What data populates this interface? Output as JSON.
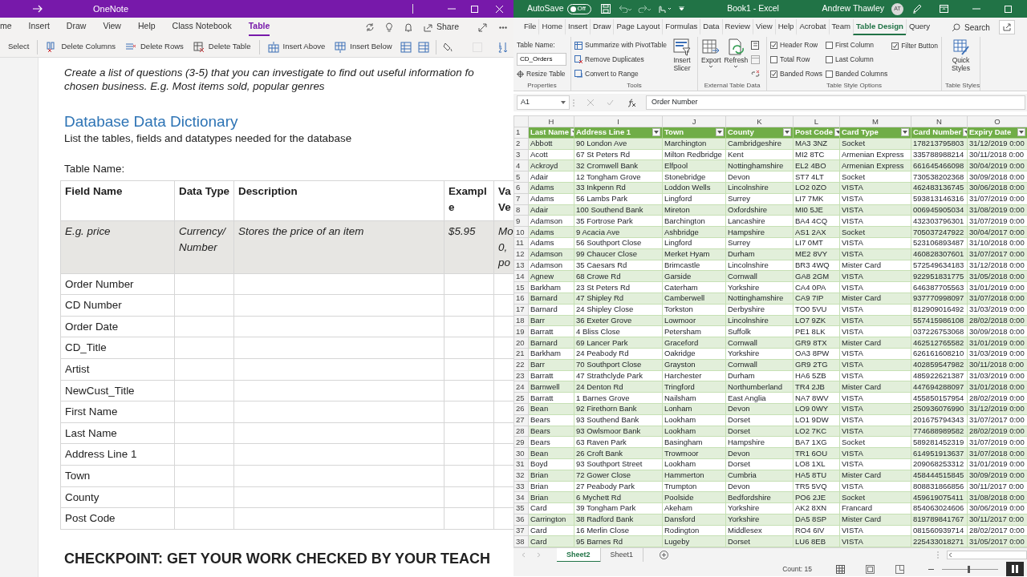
{
  "onenote": {
    "title": "OneNote",
    "tabs": [
      {
        "label": "me",
        "selected": false
      },
      {
        "label": "Insert",
        "selected": false
      },
      {
        "label": "Draw",
        "selected": false
      },
      {
        "label": "View",
        "selected": false
      },
      {
        "label": "Help",
        "selected": false
      },
      {
        "label": "Class Notebook",
        "selected": false
      },
      {
        "label": "Table",
        "selected": true
      }
    ],
    "share": "Share",
    "ribbon": [
      {
        "label": "Select",
        "kind": "text"
      },
      {
        "label": "Delete Columns",
        "kind": "delcols"
      },
      {
        "label": "Delete Rows",
        "kind": "delrows"
      },
      {
        "label": "Delete Table",
        "kind": "deltable"
      },
      {
        "label": "Insert Above",
        "kind": "insabove"
      },
      {
        "label": "Insert Below",
        "kind": "insbelow"
      }
    ],
    "page": {
      "intro_lines": [
        "Create a list of questions (3-5) that you can investigate to find out useful information fo",
        "chosen business. E.g. Most items sold, popular genres"
      ],
      "heading": "Database Data Dictionary",
      "subheading": "List the tables, fields and datatypes needed for the database",
      "table_name_label": "Table Name:",
      "columns": [
        "Field Name",
        "Data Type",
        "Description",
        "Example",
        "Va Ve"
      ],
      "example_row": [
        "E.g. price",
        "Currency/ Number",
        "Stores the price of an item",
        "$5.95",
        "Mo 0, po"
      ],
      "fields": [
        "Order Number",
        "CD Number",
        "Order Date",
        "CD_Title",
        "Artist",
        "NewCust_Title",
        "First Name",
        "Last Name",
        "Address Line 1",
        "Town",
        "County",
        "Post Code"
      ],
      "checkpoint": "CHECKPOINT: GET YOUR WORK CHECKED BY YOUR TEACH"
    }
  },
  "excel": {
    "autosave_label": "AutoSave",
    "autosave": {
      "on": false,
      "label": "Off"
    },
    "title": "Book1  -  Excel",
    "user": "Andrew Thawley",
    "avatar": "AT",
    "tabs": [
      {
        "label": "File",
        "selected": false
      },
      {
        "label": "Home",
        "selected": false
      },
      {
        "label": "Insert",
        "selected": false
      },
      {
        "label": "Draw",
        "selected": false
      },
      {
        "label": "Page Layout",
        "selected": false
      },
      {
        "label": "Formulas",
        "selected": false
      },
      {
        "label": "Data",
        "selected": false
      },
      {
        "label": "Review",
        "selected": false
      },
      {
        "label": "View",
        "selected": false
      },
      {
        "label": "Help",
        "selected": false
      },
      {
        "label": "Acrobat",
        "selected": false
      },
      {
        "label": "Team",
        "selected": false
      },
      {
        "label": "Table Design",
        "selected": true
      },
      {
        "label": "Query",
        "selected": false
      }
    ],
    "search": "Search",
    "ribbon": {
      "table_name_label": "Table Name:",
      "table_name": "CD_Orders",
      "resize": "Resize Table",
      "properties_label": "Properties",
      "tools": [
        "Summarize with PivotTable",
        "Remove Duplicates",
        "Convert to Range"
      ],
      "insert_slicer": "Insert Slicer",
      "tools_label": "Tools",
      "export": "Export",
      "refresh": "Refresh",
      "external_label": "External Table Data",
      "options": [
        {
          "label": "Header Row",
          "checked": true
        },
        {
          "label": "Total Row",
          "checked": false
        },
        {
          "label": "Banded Rows",
          "checked": true
        },
        {
          "label": "First Column",
          "checked": false
        },
        {
          "label": "Last Column",
          "checked": false
        },
        {
          "label": "Banded Columns",
          "checked": false
        },
        {
          "label": "Filter Button",
          "checked": true
        }
      ],
      "options_label": "Table Style Options",
      "quick_styles": "Quick Styles",
      "styles_label": "Table Styles"
    },
    "name_box": "A1",
    "formula": "Order Number",
    "columns": [
      "H",
      "I",
      "J",
      "K",
      "L",
      "M",
      "N",
      "O"
    ],
    "header_row": "1",
    "headers": [
      "Last Name",
      "Address Line 1",
      "Town",
      "County",
      "Post Code",
      "Card Type",
      "Card Number",
      "Expiry Date"
    ],
    "rows": [
      {
        "row": "2",
        "cells": [
          "Abbott",
          "90 London Ave",
          "Marchington",
          "Cambridgeshire",
          "MA3 3NZ",
          "Socket",
          "178213795803",
          "31/12/2019 0:00"
        ]
      },
      {
        "row": "3",
        "cells": [
          "Acott",
          "67 St Peters Rd",
          "Milton Redbridge",
          "Kent",
          "MI2 8TC",
          "Armenian Express",
          "335788988214",
          "30/11/2018 0:00"
        ]
      },
      {
        "row": "4",
        "cells": [
          "Ackroyd",
          "32 Cromwell Bank",
          "Elfpool",
          "Nottinghamshire",
          "EL2 4BO",
          "Armenian Express",
          "661645466098",
          "30/04/2019 0:00"
        ]
      },
      {
        "row": "5",
        "cells": [
          "Adair",
          "12 Tongham Grove",
          "Stonebridge",
          "Devon",
          "ST7 4LT",
          "Socket",
          "730538202368",
          "30/09/2018 0:00"
        ]
      },
      {
        "row": "6",
        "cells": [
          "Adams",
          "33 Inkpenn Rd",
          "Loddon Wells",
          "Lincolnshire",
          "LO2 0ZO",
          "VISTA",
          "462483136745",
          "30/06/2018 0:00"
        ]
      },
      {
        "row": "7",
        "cells": [
          "Adams",
          "56 Lambs Park",
          "Lingford",
          "Surrey",
          "LI7 7MK",
          "VISTA",
          "593813146316",
          "31/07/2019 0:00"
        ]
      },
      {
        "row": "8",
        "cells": [
          "Adair",
          "100 Southend Bank",
          "Mireton",
          "Oxfordshire",
          "MI0 5JE",
          "VISTA",
          "006945905034",
          "31/08/2019 0:00"
        ]
      },
      {
        "row": "9",
        "cells": [
          "Adamson",
          "35 Fortrose Park",
          "Barchington",
          "Lancashire",
          "BA4 4CQ",
          "VISTA",
          "432303796301",
          "31/07/2019 0:00"
        ]
      },
      {
        "row": "10",
        "cells": [
          "Adams",
          "9 Acacia Ave",
          "Ashbridge",
          "Hampshire",
          "AS1 2AX",
          "Socket",
          "705037247922",
          "30/04/2017 0:00"
        ]
      },
      {
        "row": "11",
        "cells": [
          "Adams",
          "56 Southport Close",
          "Lingford",
          "Surrey",
          "LI7 0MT",
          "VISTA",
          "523106893487",
          "31/10/2018 0:00"
        ]
      },
      {
        "row": "12",
        "cells": [
          "Adamson",
          "99 Chaucer Close",
          "Merket Hyam",
          "Durham",
          "ME2 8VY",
          "VISTA",
          "460828307601",
          "31/07/2017 0:00"
        ]
      },
      {
        "row": "13",
        "cells": [
          "Adamson",
          "35 Caesars Rd",
          "Brimcastle",
          "Lincolnshire",
          "BR3 4WQ",
          "Mister Card",
          "572549634183",
          "31/12/2018 0:00"
        ]
      },
      {
        "row": "14",
        "cells": [
          "Agnew",
          "68 Crowe Rd",
          "Garside",
          "Cornwall",
          "GA8 2GM",
          "VISTA",
          "922951831775",
          "31/05/2018 0:00"
        ]
      },
      {
        "row": "15",
        "cells": [
          "Barkham",
          "23 St Peters Rd",
          "Caterham",
          "Yorkshire",
          "CA4 0PA",
          "VISTA",
          "646387705563",
          "31/01/2019 0:00"
        ]
      },
      {
        "row": "16",
        "cells": [
          "Barnard",
          "47 Shipley Rd",
          "Camberwell",
          "Nottinghamshire",
          "CA9 7IP",
          "Mister Card",
          "937770998097",
          "31/07/2018 0:00"
        ]
      },
      {
        "row": "17",
        "cells": [
          "Barnard",
          "24 Shipley Close",
          "Torkston",
          "Derbyshire",
          "TO0 5VU",
          "VISTA",
          "812909016492",
          "31/03/2019 0:00"
        ]
      },
      {
        "row": "18",
        "cells": [
          "Barr",
          "36 Exeter Grove",
          "Lowmoor",
          "Lincolnshire",
          "LO7 9ZK",
          "VISTA",
          "557415986108",
          "28/02/2018 0:00"
        ]
      },
      {
        "row": "19",
        "cells": [
          "Barratt",
          "4 Bliss Close",
          "Petersham",
          "Suffolk",
          "PE1 8LK",
          "VISTA",
          "037226753068",
          "30/09/2018 0:00"
        ]
      },
      {
        "row": "20",
        "cells": [
          "Barnard",
          "69 Lancer Park",
          "Graceford",
          "Cornwall",
          "GR9 8TX",
          "Mister Card",
          "462512765582",
          "31/01/2019 0:00"
        ]
      },
      {
        "row": "21",
        "cells": [
          "Barkham",
          "24 Peabody Rd",
          "Oakridge",
          "Yorkshire",
          "OA3 8PW",
          "VISTA",
          "626161608210",
          "31/03/2019 0:00"
        ]
      },
      {
        "row": "22",
        "cells": [
          "Barr",
          "70 Southport Close",
          "Grayston",
          "Cornwall",
          "GR9 2TG",
          "VISTA",
          "402859547982",
          "30/11/2018 0:00"
        ]
      },
      {
        "row": "23",
        "cells": [
          "Barratt",
          "47 Strathclyde Park",
          "Harchester",
          "Durham",
          "HA6 5ZB",
          "VISTA",
          "485922621387",
          "31/03/2019 0:00"
        ]
      },
      {
        "row": "24",
        "cells": [
          "Barnwell",
          "24 Denton Rd",
          "Tringford",
          "Northumberland",
          "TR4 2JB",
          "Mister Card",
          "447694288097",
          "31/01/2018 0:00"
        ]
      },
      {
        "row": "25",
        "cells": [
          "Barratt",
          "1 Barnes Grove",
          "Nailsham",
          "East Anglia",
          "NA7 8WV",
          "VISTA",
          "455850157954",
          "28/02/2019 0:00"
        ]
      },
      {
        "row": "26",
        "cells": [
          "Bean",
          "92 Firethorn Bank",
          "Lonham",
          "Devon",
          "LO9 0WY",
          "VISTA",
          "250936076990",
          "31/12/2019 0:00"
        ]
      },
      {
        "row": "27",
        "cells": [
          "Bears",
          "93 Southend Bank",
          "Lookham",
          "Dorset",
          "LO1 9DW",
          "VISTA",
          "201675794343",
          "31/07/2017 0:00"
        ]
      },
      {
        "row": "28",
        "cells": [
          "Bears",
          "93 Owlsmoor Bank",
          "Lookham",
          "Dorset",
          "LO2 7KC",
          "VISTA",
          "774688989582",
          "28/02/2019 0:00"
        ]
      },
      {
        "row": "29",
        "cells": [
          "Bears",
          "63 Raven Park",
          "Basingham",
          "Hampshire",
          "BA7 1XG",
          "Socket",
          "589281452319",
          "31/07/2019 0:00"
        ]
      },
      {
        "row": "30",
        "cells": [
          "Bean",
          "26 Croft Bank",
          "Trowmoor",
          "Devon",
          "TR1 6OU",
          "VISTA",
          "614951913637",
          "31/07/2018 0:00"
        ]
      },
      {
        "row": "31",
        "cells": [
          "Boyd",
          "93 Southport Street",
          "Lookham",
          "Dorset",
          "LO8 1XL",
          "VISTA",
          "209068253312",
          "31/01/2019 0:00"
        ]
      },
      {
        "row": "32",
        "cells": [
          "Brian",
          "72 Gower Close",
          "Hammerton",
          "Cumbria",
          "HA5 8TU",
          "Mister Card",
          "458444515845",
          "30/09/2019 0:00"
        ]
      },
      {
        "row": "33",
        "cells": [
          "Brian",
          "27 Peabody Park",
          "Trumpton",
          "Devon",
          "TR5 5VQ",
          "VISTA",
          "808831866856",
          "30/11/2017 0:00"
        ]
      },
      {
        "row": "34",
        "cells": [
          "Brian",
          "6 Mychett Rd",
          "Poolside",
          "Bedfordshire",
          "PO6 2JE",
          "Socket",
          "459619075411",
          "31/08/2018 0:00"
        ]
      },
      {
        "row": "35",
        "cells": [
          "Card",
          "39 Tongham Park",
          "Akeham",
          "Yorkshire",
          "AK2 8XN",
          "Francard",
          "854063024606",
          "30/06/2019 0:00"
        ]
      },
      {
        "row": "36",
        "cells": [
          "Carrington",
          "38 Radford Bank",
          "Dansford",
          "Yorkshire",
          "DA5 8SP",
          "Mister Card",
          "819789841767",
          "30/11/2017 0:00"
        ]
      },
      {
        "row": "37",
        "cells": [
          "Card",
          "16 Merlin Close",
          "Rodington",
          "Middlesex",
          "RO4 6IV",
          "VISTA",
          "081560939714",
          "28/02/2017 0:00"
        ]
      },
      {
        "row": "38",
        "cells": [
          "Card",
          "95 Barnes Rd",
          "Lugeby",
          "Dorset",
          "LU6 8EB",
          "VISTA",
          "225433018271",
          "31/05/2017 0:00"
        ]
      }
    ],
    "sheets": [
      {
        "label": "Sheet2",
        "selected": true
      },
      {
        "label": "Sheet1",
        "selected": false
      }
    ],
    "status": "Count: 15",
    "zoom_slider": {
      "level": 0.48
    }
  }
}
